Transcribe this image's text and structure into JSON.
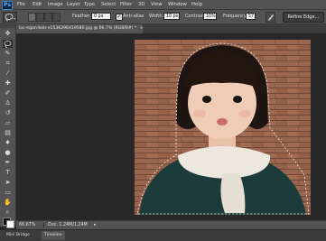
{
  "app": {
    "logo": "Ps"
  },
  "menu": [
    "File",
    "Edit",
    "Image",
    "Layer",
    "Type",
    "Select",
    "Filter",
    "3D",
    "View",
    "Window",
    "Help"
  ],
  "options": {
    "feather_label": "Feather:",
    "feather_value": "0 px",
    "antialias_label": "Anti-alias",
    "antialias_checked": true,
    "width_label": "Width:",
    "width_value": "10 px",
    "contrast_label": "Contrast:",
    "contrast_value": "10%",
    "frequency_label": "Frequency:",
    "frequency_value": "57",
    "refine_label": "Refine Edge..."
  },
  "tools": [
    "move-icon",
    "lasso-icon",
    "quick-select-icon",
    "crop-icon",
    "eyedropper-icon",
    "healing-icon",
    "brush-icon",
    "clone-stamp-icon",
    "history-brush-icon",
    "eraser-icon",
    "gradient-icon",
    "blur-icon",
    "dodge-icon",
    "pen-icon",
    "type-icon",
    "path-select-icon",
    "rectangle-icon",
    "hand-icon",
    "zoom-icon"
  ],
  "document": {
    "tab_title": "loc-egan-bob-e1536296419580.jpg @ 66.7% (RGB/8#) *",
    "close_glyph": "×"
  },
  "status": {
    "zoom": "66.67%",
    "doc_size": "Doc: 1.24M/1.24M",
    "arrow_glyph": "▸"
  },
  "bottom_tabs": [
    "Mini Bridge",
    "Timeline"
  ],
  "colors": {
    "foreground": "#111111",
    "background": "#ffffff",
    "accent": "#2f88d8"
  }
}
